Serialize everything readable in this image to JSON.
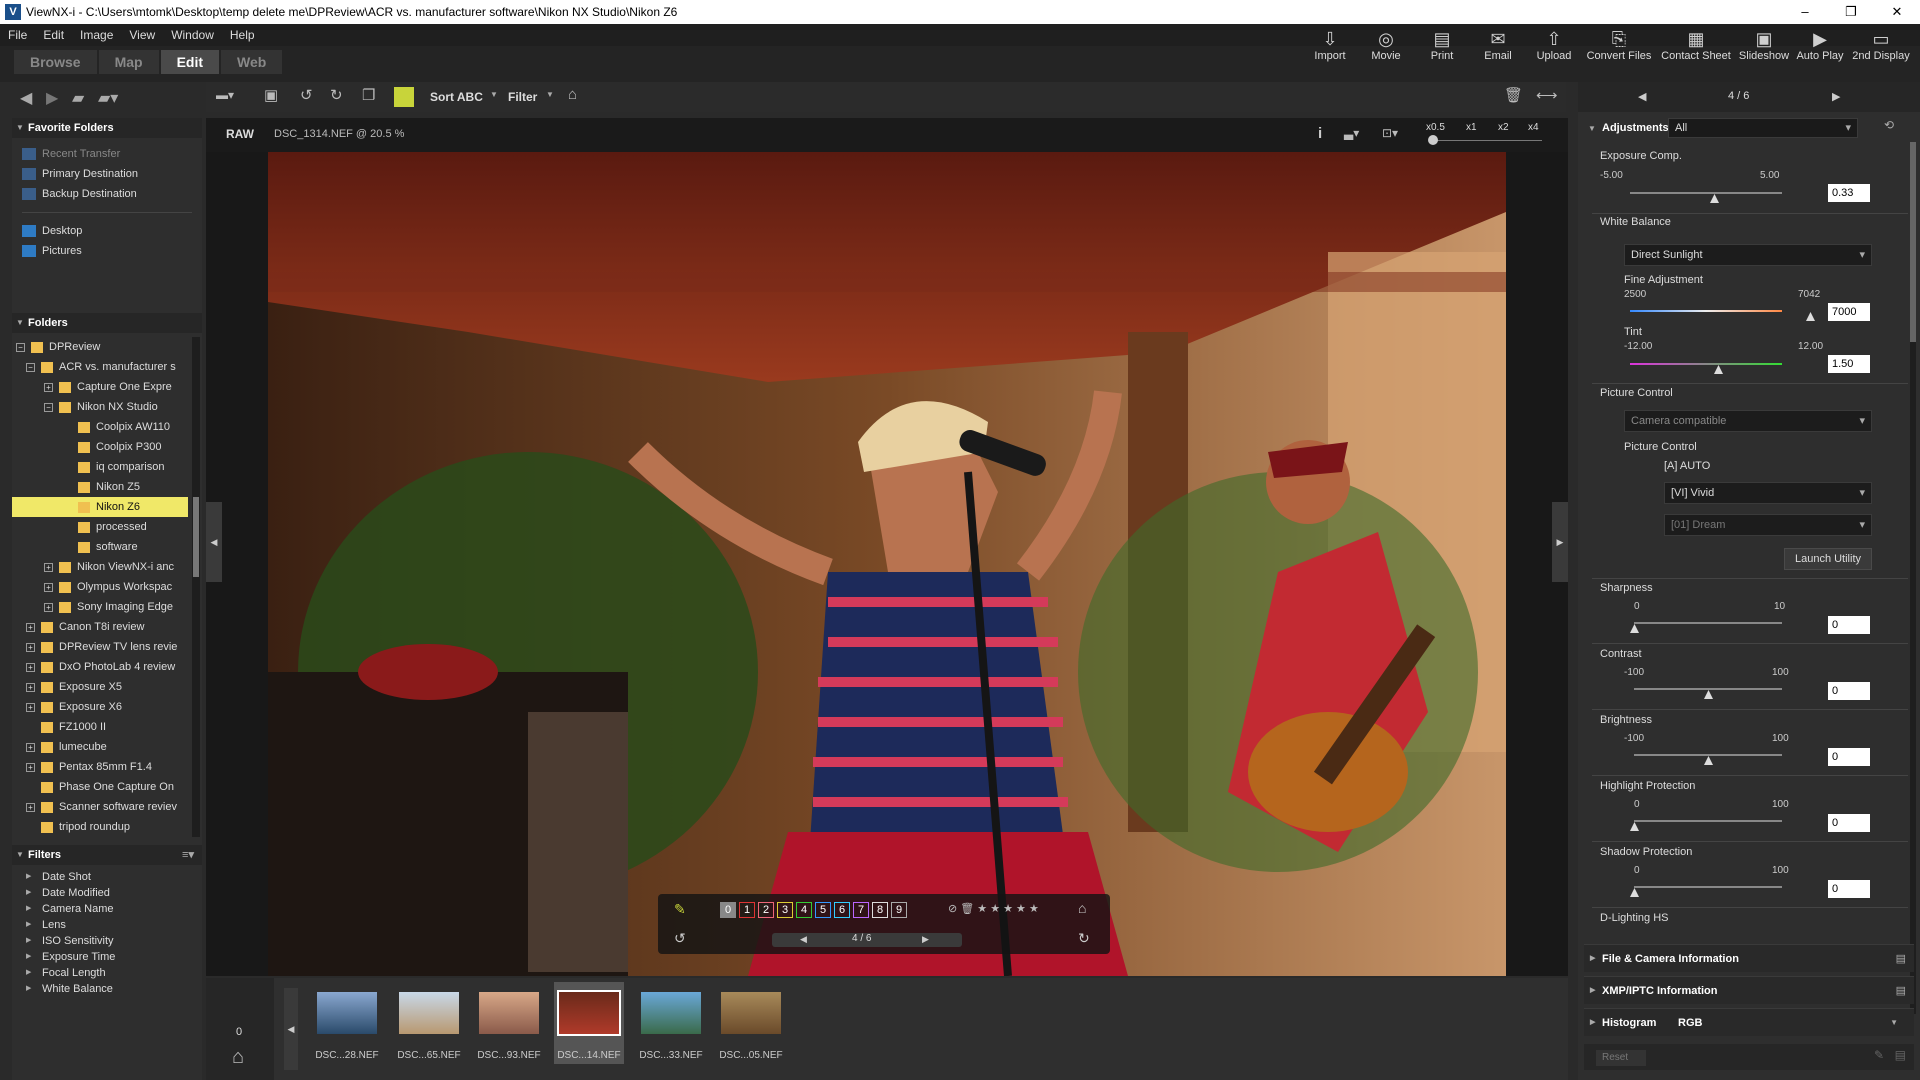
{
  "titlebar": {
    "title": "ViewNX-i - C:\\Users\\mtomk\\Desktop\\temp delete me\\DPReview\\ACR vs. manufacturer software\\Nikon NX Studio\\Nikon Z6",
    "minimize": "–",
    "maximize": "❐",
    "close": "✕"
  },
  "menu": [
    "File",
    "Edit",
    "Image",
    "View",
    "Window",
    "Help"
  ],
  "modes": [
    "Browse",
    "Map",
    "Edit",
    "Web"
  ],
  "top_tools": [
    "Import",
    "Movie",
    "Print",
    "Email",
    "Upload",
    "Convert Files",
    "Contact Sheet",
    "Slideshow",
    "Auto Play",
    "2nd Display"
  ],
  "toolbar": {
    "sort": "Sort ABC",
    "filter": "Filter"
  },
  "image": {
    "format": "RAW",
    "name": "DSC_1314.NEF @ 20.5 %",
    "zoom": [
      "x0.5",
      "x1",
      "x2",
      "x4"
    ]
  },
  "favorites": {
    "header": "Favorite Folders",
    "items": [
      "Recent Transfer",
      "Primary Destination",
      "Backup Destination",
      "Desktop",
      "Pictures"
    ]
  },
  "folders": {
    "header": "Folders",
    "items": [
      "DPReview",
      "ACR vs. manufacturer s",
      "Capture One Expre",
      "Nikon NX Studio",
      "Coolpix AW110",
      "Coolpix P300",
      "iq comparison",
      "Nikon Z5",
      "Nikon Z6",
      "processed",
      "software",
      "Nikon ViewNX-i anc",
      "Olympus Workspac",
      "Sony Imaging Edge",
      "Canon T8i review",
      "DPReview TV lens revie",
      "DxO PhotoLab 4 review",
      "Exposure X5",
      "Exposure X6",
      "FZ1000 II",
      "lumecube",
      "Pentax 85mm F1.4",
      "Phase One Capture On",
      "Scanner software reviev",
      "tripod roundup"
    ]
  },
  "filters": {
    "header": "Filters",
    "items": [
      "Date Shot",
      "Date Modified",
      "Camera Name",
      "Lens",
      "ISO Sensitivity",
      "Exposure Time",
      "Focal Length",
      "White Balance"
    ]
  },
  "overlay": {
    "labels": [
      "0",
      "1",
      "2",
      "3",
      "4",
      "5",
      "6",
      "7",
      "8",
      "9"
    ],
    "counter": "4 / 6"
  },
  "filmstrip": {
    "count": "0",
    "thumbs": [
      "DSC...28.NEF",
      "DSC...65.NEF",
      "DSC...93.NEF",
      "DSC...14.NEF",
      "DSC...33.NEF",
      "DSC...05.NEF"
    ],
    "selected_index": 3
  },
  "right": {
    "nav": "4 / 6",
    "adjustments": "Adjustments",
    "adjust_filter": "All",
    "exposure": {
      "label": "Exposure Comp.",
      "min": "-5.00",
      "max": "5.00",
      "value": "0.33"
    },
    "wb": {
      "label": "White Balance",
      "preset": "Direct Sunlight",
      "fine": "Fine Adjustment",
      "min": "2500",
      "max": "7042",
      "value": "7000"
    },
    "tint": {
      "label": "Tint",
      "min": "-12.00",
      "max": "12.00",
      "value": "1.50"
    },
    "pc": {
      "label": "Picture Control",
      "mode": "Camera compatible",
      "sub": "Picture Control",
      "auto": "[A] AUTO",
      "style": "[VI] Vivid",
      "creative": "[01] Dream",
      "launch": "Launch Utility"
    },
    "sharpness": {
      "label": "Sharpness",
      "min": "0",
      "max": "10",
      "value": "0"
    },
    "contrast": {
      "label": "Contrast",
      "min": "-100",
      "max": "100",
      "value": "0"
    },
    "brightness": {
      "label": "Brightness",
      "min": "-100",
      "max": "100",
      "value": "0"
    },
    "highlight": {
      "label": "Highlight Protection",
      "min": "0",
      "max": "100",
      "value": "0"
    },
    "shadow": {
      "label": "Shadow Protection",
      "min": "0",
      "max": "100",
      "value": "0"
    },
    "dlighting": {
      "label": "D-Lighting HS"
    },
    "sections": [
      "File & Camera Information",
      "XMP/IPTC Information",
      "Histogram"
    ],
    "histogram_mode": "RGB",
    "reset": "Reset"
  }
}
